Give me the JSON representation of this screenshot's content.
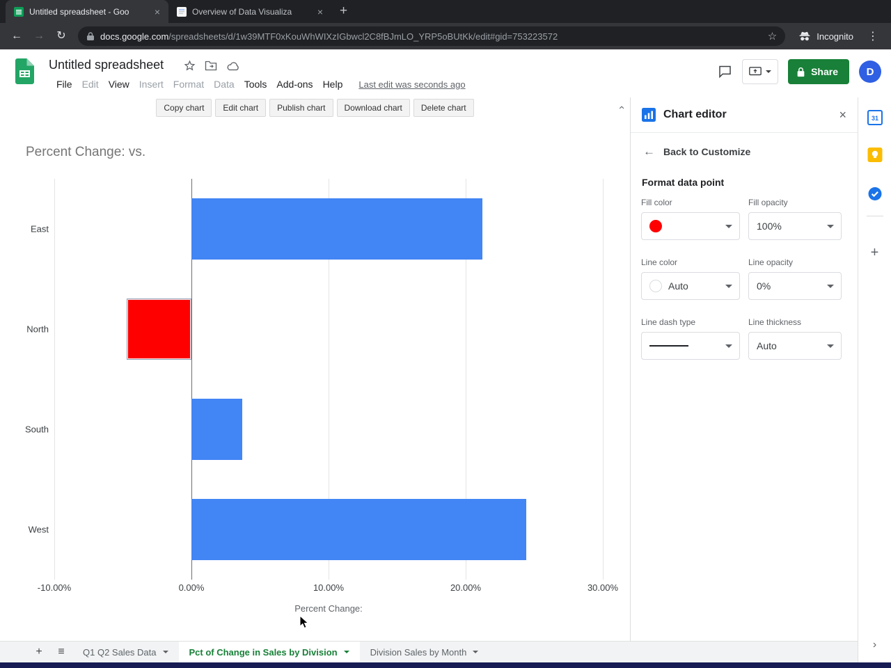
{
  "browser": {
    "tabs": [
      {
        "title": "Untitled spreadsheet - Goo",
        "close": "×"
      },
      {
        "title": "Overview of Data Visualiza",
        "close": "×"
      }
    ],
    "new_tab": "+",
    "back": "←",
    "forward": "→",
    "reload": "↻",
    "url_domain": "docs.google.com",
    "url_path": "/spreadsheets/d/1w39MTF0xKouWhWIXzIGbwcl2C8fBJmLO_YRP5oBUtKk/edit#gid=753223572",
    "star": "☆",
    "incognito_label": "Incognito",
    "menu": "⋮"
  },
  "header": {
    "doc_title": "Untitled spreadsheet",
    "menus": [
      {
        "label": "File",
        "muted": false
      },
      {
        "label": "Edit",
        "muted": true
      },
      {
        "label": "View",
        "muted": false
      },
      {
        "label": "Insert",
        "muted": true
      },
      {
        "label": "Format",
        "muted": true
      },
      {
        "label": "Data",
        "muted": true
      },
      {
        "label": "Tools",
        "muted": false
      },
      {
        "label": "Add-ons",
        "muted": false
      },
      {
        "label": "Help",
        "muted": false
      }
    ],
    "last_edit": "Last edit was seconds ago",
    "share_label": "Share",
    "share_color": "#188038",
    "avatar_letter": "D",
    "avatar_color": "#2f5fe3"
  },
  "chart_toolbar": {
    "buttons": [
      "Copy chart",
      "Edit chart",
      "Publish chart",
      "Download chart",
      "Delete chart"
    ],
    "collapse": "›"
  },
  "chart_data": {
    "type": "bar",
    "orientation": "horizontal",
    "title": "Percent Change: vs.",
    "categories": [
      "East",
      "North",
      "South",
      "West"
    ],
    "values": [
      21.2,
      -4.7,
      3.7,
      24.4
    ],
    "bar_colors": [
      "#4285f4",
      "#ff0000",
      "#4285f4",
      "#4285f4"
    ],
    "default_color": "#4285f4",
    "selected_index": 1,
    "selected_color": "#ff0000",
    "xlabel": "Percent Change:",
    "x_ticks": [
      {
        "label": "-10.00%",
        "value": -10
      },
      {
        "label": "0.00%",
        "value": 0
      },
      {
        "label": "10.00%",
        "value": 10
      },
      {
        "label": "20.00%",
        "value": 20
      },
      {
        "label": "30.00%",
        "value": 30
      }
    ],
    "xlim": [
      -10,
      30
    ],
    "grid": true,
    "legend": "none"
  },
  "chart_editor": {
    "title": "Chart editor",
    "close": "×",
    "back_arrow": "←",
    "back_label": "Back to Customize",
    "section_title": "Format data point",
    "fill_color": {
      "label": "Fill color",
      "swatch_color": "#ff0000"
    },
    "fill_opacity": {
      "label": "Fill opacity",
      "value": "100%"
    },
    "line_color": {
      "label": "Line color",
      "value": "Auto"
    },
    "line_opacity": {
      "label": "Line opacity",
      "value": "0%"
    },
    "line_dash_type": {
      "label": "Line dash type",
      "value": "solid"
    },
    "line_thickness": {
      "label": "Line thickness",
      "value": "Auto"
    }
  },
  "side_panel": {
    "calendar_label": "31",
    "add": "+",
    "chevron": "›"
  },
  "sheet_bar": {
    "add": "+",
    "all_sheets": "≡",
    "tabs": [
      {
        "label": "Q1 Q2 Sales Data",
        "active": false
      },
      {
        "label": "Pct of Change in Sales by Division",
        "active": true,
        "active_color": "#188038"
      },
      {
        "label": "Division Sales by Month",
        "active": false
      }
    ],
    "scroll_right": "›"
  }
}
